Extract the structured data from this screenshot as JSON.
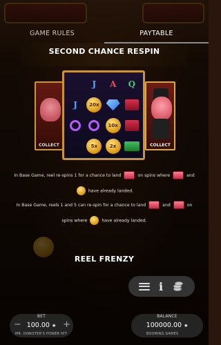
{
  "tabs": [
    {
      "label": "GAME RULES"
    },
    {
      "label": "PAYTABLE"
    }
  ],
  "sections": {
    "second_chance": {
      "title": "SECOND CHANCE RESPIN",
      "collect_left": "COLLECT",
      "collect_right": "COLLECT",
      "reels": [
        [
          "",
          "J",
          "A",
          "Q"
        ],
        [
          "",
          "20x",
          "gem",
          ""
        ],
        [
          "",
          "ring",
          "10x",
          ""
        ],
        [
          "",
          "5x",
          "2x",
          "cash"
        ]
      ],
      "para1_line1_a": "In Base Game, reel re-spins 1 for a chance to land",
      "para1_line1_b": "on spins where",
      "para1_line1_c": "and",
      "para1_line2": "have already landed.",
      "para2_line1_a": "In Base Game, reels 1 and 5 can re-spin for a chance to land",
      "para2_line1_b": "and",
      "para2_line1_c": "on",
      "para2_line2_a": "spins where",
      "para2_line2_b": "have already landed."
    },
    "reel_frenzy": {
      "title": "REEL FRENZY"
    }
  },
  "icons": {
    "menu": "hamburger-menu-icon",
    "info": "info-icon",
    "bet_settings": "coin-stack-icon"
  },
  "bet": {
    "label": "BET",
    "value": "100.00",
    "star": "★",
    "minus": "−",
    "plus": "+",
    "game_name": "MR. OINKSTER'S POWER HIT"
  },
  "balance": {
    "label": "BALANCE",
    "value": "100000.00",
    "star": "★",
    "provider": "BOOMING GAMES"
  },
  "colors": {
    "background": "#2a160c",
    "gold_border": "#c99534",
    "panel": "#282828"
  }
}
